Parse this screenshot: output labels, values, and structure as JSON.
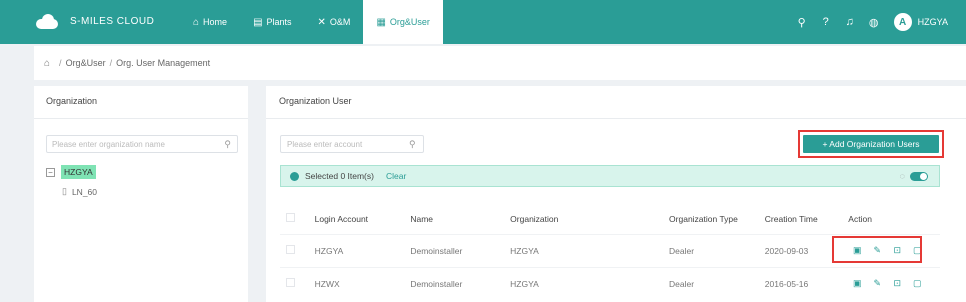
{
  "brand": {
    "name": "S-MILES CLOUD"
  },
  "nav": {
    "items": [
      {
        "label": "Home",
        "icon": "home-icon",
        "glyph": "⌂"
      },
      {
        "label": "Plants",
        "icon": "plants-icon",
        "glyph": "▤"
      },
      {
        "label": "O&M",
        "icon": "tools-icon",
        "glyph": "✕"
      },
      {
        "label": "Org&User",
        "icon": "org-icon",
        "glyph": "▦"
      }
    ],
    "active": "Org&User"
  },
  "header": {
    "username": "HZGYA",
    "avatar_letter": "A"
  },
  "breadcrumb": {
    "items": [
      "Org&User",
      "Org. User Management"
    ]
  },
  "left_panel": {
    "title": "Organization",
    "search_placeholder": "Please enter organization name",
    "tree": {
      "root": "HZGYA",
      "children": [
        "LN_60"
      ]
    }
  },
  "right_panel": {
    "title": "Organization User",
    "search_placeholder": "Please enter account",
    "add_button": "+ Add Organization Users",
    "selection": {
      "text": "Selected 0 Item(s)",
      "clear": "Clear"
    },
    "table": {
      "columns": [
        "Login Account",
        "Name",
        "Organization",
        "Organization Type",
        "Creation Time",
        "Action"
      ],
      "rows": [
        [
          "HZGYA",
          "Demoinstaller",
          "HZGYA",
          "Dealer",
          "2020-09-03"
        ],
        [
          "HZWX",
          "Demoinstaller",
          "HZGYA",
          "Dealer",
          "2016-05-16"
        ]
      ]
    }
  },
  "colors": {
    "primary": "#2a9d96",
    "highlight": "#e53935",
    "selected_node": "#7fe3b4"
  }
}
